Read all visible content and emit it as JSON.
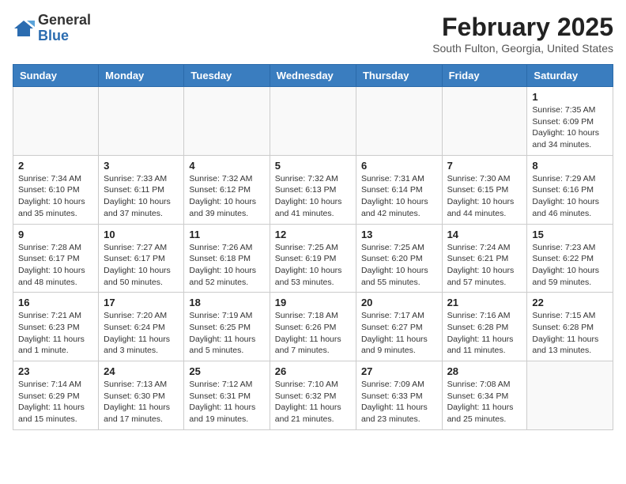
{
  "logo": {
    "general": "General",
    "blue": "Blue"
  },
  "header": {
    "month": "February 2025",
    "location": "South Fulton, Georgia, United States"
  },
  "days_of_week": [
    "Sunday",
    "Monday",
    "Tuesday",
    "Wednesday",
    "Thursday",
    "Friday",
    "Saturday"
  ],
  "weeks": [
    [
      {
        "day": "",
        "info": ""
      },
      {
        "day": "",
        "info": ""
      },
      {
        "day": "",
        "info": ""
      },
      {
        "day": "",
        "info": ""
      },
      {
        "day": "",
        "info": ""
      },
      {
        "day": "",
        "info": ""
      },
      {
        "day": "1",
        "info": "Sunrise: 7:35 AM\nSunset: 6:09 PM\nDaylight: 10 hours\nand 34 minutes."
      }
    ],
    [
      {
        "day": "2",
        "info": "Sunrise: 7:34 AM\nSunset: 6:10 PM\nDaylight: 10 hours\nand 35 minutes."
      },
      {
        "day": "3",
        "info": "Sunrise: 7:33 AM\nSunset: 6:11 PM\nDaylight: 10 hours\nand 37 minutes."
      },
      {
        "day": "4",
        "info": "Sunrise: 7:32 AM\nSunset: 6:12 PM\nDaylight: 10 hours\nand 39 minutes."
      },
      {
        "day": "5",
        "info": "Sunrise: 7:32 AM\nSunset: 6:13 PM\nDaylight: 10 hours\nand 41 minutes."
      },
      {
        "day": "6",
        "info": "Sunrise: 7:31 AM\nSunset: 6:14 PM\nDaylight: 10 hours\nand 42 minutes."
      },
      {
        "day": "7",
        "info": "Sunrise: 7:30 AM\nSunset: 6:15 PM\nDaylight: 10 hours\nand 44 minutes."
      },
      {
        "day": "8",
        "info": "Sunrise: 7:29 AM\nSunset: 6:16 PM\nDaylight: 10 hours\nand 46 minutes."
      }
    ],
    [
      {
        "day": "9",
        "info": "Sunrise: 7:28 AM\nSunset: 6:17 PM\nDaylight: 10 hours\nand 48 minutes."
      },
      {
        "day": "10",
        "info": "Sunrise: 7:27 AM\nSunset: 6:17 PM\nDaylight: 10 hours\nand 50 minutes."
      },
      {
        "day": "11",
        "info": "Sunrise: 7:26 AM\nSunset: 6:18 PM\nDaylight: 10 hours\nand 52 minutes."
      },
      {
        "day": "12",
        "info": "Sunrise: 7:25 AM\nSunset: 6:19 PM\nDaylight: 10 hours\nand 53 minutes."
      },
      {
        "day": "13",
        "info": "Sunrise: 7:25 AM\nSunset: 6:20 PM\nDaylight: 10 hours\nand 55 minutes."
      },
      {
        "day": "14",
        "info": "Sunrise: 7:24 AM\nSunset: 6:21 PM\nDaylight: 10 hours\nand 57 minutes."
      },
      {
        "day": "15",
        "info": "Sunrise: 7:23 AM\nSunset: 6:22 PM\nDaylight: 10 hours\nand 59 minutes."
      }
    ],
    [
      {
        "day": "16",
        "info": "Sunrise: 7:21 AM\nSunset: 6:23 PM\nDaylight: 11 hours\nand 1 minute."
      },
      {
        "day": "17",
        "info": "Sunrise: 7:20 AM\nSunset: 6:24 PM\nDaylight: 11 hours\nand 3 minutes."
      },
      {
        "day": "18",
        "info": "Sunrise: 7:19 AM\nSunset: 6:25 PM\nDaylight: 11 hours\nand 5 minutes."
      },
      {
        "day": "19",
        "info": "Sunrise: 7:18 AM\nSunset: 6:26 PM\nDaylight: 11 hours\nand 7 minutes."
      },
      {
        "day": "20",
        "info": "Sunrise: 7:17 AM\nSunset: 6:27 PM\nDaylight: 11 hours\nand 9 minutes."
      },
      {
        "day": "21",
        "info": "Sunrise: 7:16 AM\nSunset: 6:28 PM\nDaylight: 11 hours\nand 11 minutes."
      },
      {
        "day": "22",
        "info": "Sunrise: 7:15 AM\nSunset: 6:28 PM\nDaylight: 11 hours\nand 13 minutes."
      }
    ],
    [
      {
        "day": "23",
        "info": "Sunrise: 7:14 AM\nSunset: 6:29 PM\nDaylight: 11 hours\nand 15 minutes."
      },
      {
        "day": "24",
        "info": "Sunrise: 7:13 AM\nSunset: 6:30 PM\nDaylight: 11 hours\nand 17 minutes."
      },
      {
        "day": "25",
        "info": "Sunrise: 7:12 AM\nSunset: 6:31 PM\nDaylight: 11 hours\nand 19 minutes."
      },
      {
        "day": "26",
        "info": "Sunrise: 7:10 AM\nSunset: 6:32 PM\nDaylight: 11 hours\nand 21 minutes."
      },
      {
        "day": "27",
        "info": "Sunrise: 7:09 AM\nSunset: 6:33 PM\nDaylight: 11 hours\nand 23 minutes."
      },
      {
        "day": "28",
        "info": "Sunrise: 7:08 AM\nSunset: 6:34 PM\nDaylight: 11 hours\nand 25 minutes."
      },
      {
        "day": "",
        "info": ""
      }
    ]
  ]
}
